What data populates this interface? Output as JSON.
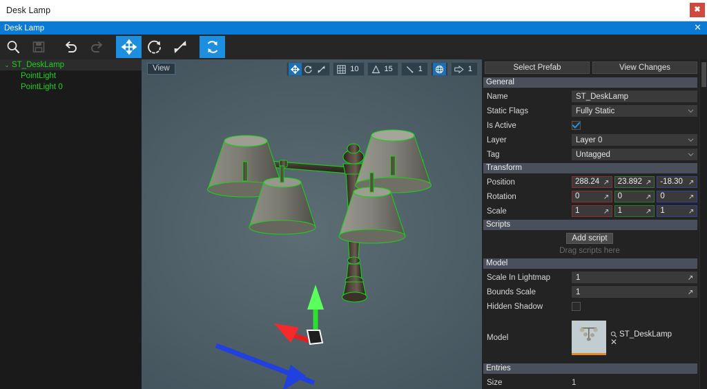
{
  "window": {
    "title": "Desk Lamp",
    "close_label": "✖"
  },
  "document_tab": {
    "title": "Desk Lamp",
    "close_label": "✕"
  },
  "toolbar": {
    "buttons": [
      {
        "name": "search-icon",
        "label": "Search",
        "state": "normal"
      },
      {
        "name": "save-icon",
        "label": "Save",
        "state": "disabled"
      },
      {
        "name": "undo-icon",
        "label": "Undo",
        "state": "normal"
      },
      {
        "name": "redo-icon",
        "label": "Redo",
        "state": "disabled"
      },
      {
        "name": "move-tool-icon",
        "label": "Move",
        "state": "active"
      },
      {
        "name": "rotate-tool-icon",
        "label": "Rotate",
        "state": "normal"
      },
      {
        "name": "scale-tool-icon",
        "label": "Scale",
        "state": "normal"
      },
      {
        "name": "sync-icon",
        "label": "Sync",
        "state": "active"
      }
    ]
  },
  "hierarchy": {
    "nodes": [
      {
        "label": "ST_DeskLamp",
        "depth": 0,
        "expanded": true,
        "selected": true,
        "twisty": "⌄"
      },
      {
        "label": "PointLight",
        "depth": 1,
        "expanded": false,
        "selected": false,
        "twisty": ""
      },
      {
        "label": "PointLight 0",
        "depth": 1,
        "expanded": false,
        "selected": false,
        "twisty": ""
      }
    ],
    "text_color": "#1ed31e"
  },
  "viewport": {
    "view_label": "View",
    "tools": [
      {
        "name": "move-gizmo-icon",
        "icon": "move",
        "active": true,
        "value": null
      },
      {
        "name": "rotate-gizmo-icon",
        "icon": "rotate",
        "active": false,
        "value": null
      },
      {
        "name": "scale-gizmo-icon",
        "icon": "scale",
        "active": false,
        "value": null
      },
      {
        "name": "grid-snap-icon",
        "icon": "grid",
        "active": false,
        "value": "10"
      },
      {
        "name": "angle-snap-icon",
        "icon": "angle",
        "active": false,
        "value": "15"
      },
      {
        "name": "scale-snap-icon",
        "icon": "ruler",
        "active": false,
        "value": "1"
      },
      {
        "name": "world-space-icon",
        "icon": "globe",
        "active": true,
        "value": null
      },
      {
        "name": "pivot-mode-icon",
        "icon": "arrow",
        "active": false,
        "value": "1"
      }
    ],
    "selection_outline_color": "#18d018",
    "gizmo": {
      "x_color": "#e02020",
      "y_color": "#2ee02e",
      "z_color": "#2040e0"
    }
  },
  "inspector": {
    "select_prefab_label": "Select Prefab",
    "view_changes_label": "View Changes",
    "sections": {
      "general": {
        "title": "General",
        "name": {
          "label": "Name",
          "value": "ST_DeskLamp"
        },
        "static_flags": {
          "label": "Static Flags",
          "value": "Fully Static"
        },
        "is_active": {
          "label": "Is Active",
          "checked": true
        },
        "layer": {
          "label": "Layer",
          "value": "Layer 0"
        },
        "tag": {
          "label": "Tag",
          "value": "Untagged"
        }
      },
      "transform": {
        "title": "Transform",
        "position": {
          "label": "Position",
          "x": "288.24",
          "y": "23.892",
          "z": "-18.30"
        },
        "rotation": {
          "label": "Rotation",
          "x": "0",
          "y": "0",
          "z": "0"
        },
        "scale": {
          "label": "Scale",
          "x": "1",
          "y": "1",
          "z": "1"
        }
      },
      "scripts": {
        "title": "Scripts",
        "add_script_label": "Add script",
        "drag_hint": "Drag scripts here"
      },
      "model": {
        "title": "Model",
        "scale_in_lightmap": {
          "label": "Scale In Lightmap",
          "value": "1"
        },
        "bounds_scale": {
          "label": "Bounds Scale",
          "value": "1"
        },
        "hidden_shadow": {
          "label": "Hidden Shadow",
          "checked": false
        },
        "model_field": {
          "label": "Model",
          "value": "ST_DeskLamp",
          "clear_label": "✕",
          "accent": "#e58a22"
        }
      },
      "entries": {
        "title": "Entries",
        "size": {
          "label": "Size",
          "value": "1"
        }
      }
    }
  }
}
